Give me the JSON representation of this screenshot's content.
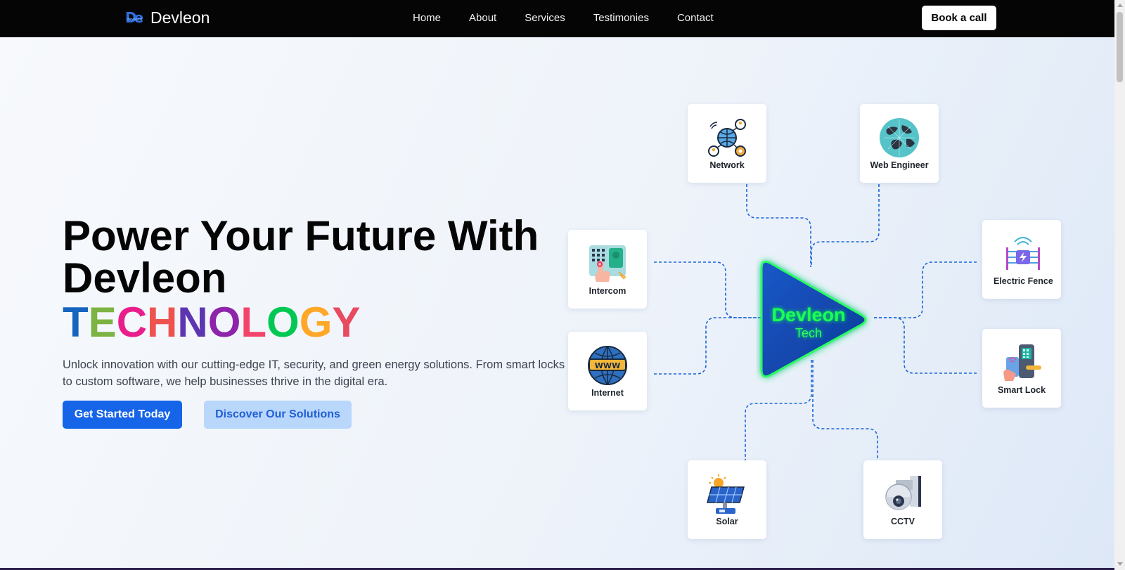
{
  "brand": {
    "name": "Devleon",
    "mark": "De",
    "mark_sub": "devleon"
  },
  "nav": {
    "items": [
      "Home",
      "About",
      "Services",
      "Testimonies",
      "Contact"
    ],
    "cta": "Book a call"
  },
  "hero": {
    "headline": "Power Your Future With Devleon",
    "highlight": "TECHNOLOGY",
    "highlight_colors": [
      "#1565c0",
      "#7cb342",
      "#e91e8c",
      "#ef5350",
      "#5e35b1",
      "#8e24aa",
      "#f4436b",
      "#00c853",
      "#ffa726",
      "#e84a5f",
      "#00bcd4",
      "#26c6da"
    ],
    "lead": "Unlock innovation with our cutting-edge IT, security, and green energy solutions. From smart locks to custom software, we help businesses thrive in the digital era.",
    "primary_button": "Get Started Today",
    "secondary_button": "Discover Our Solutions"
  },
  "diagram": {
    "center_title": "Devleon",
    "center_sub": "Tech",
    "services": [
      {
        "label": "Network",
        "icon": "network-icon"
      },
      {
        "label": "Web Engineer",
        "icon": "globe-icon"
      },
      {
        "label": "Intercom",
        "icon": "intercom-icon"
      },
      {
        "label": "Electric Fence",
        "icon": "electric-fence-icon"
      },
      {
        "label": "Internet",
        "icon": "www-globe-icon"
      },
      {
        "label": "Smart Lock",
        "icon": "smart-lock-icon"
      },
      {
        "label": "Solar",
        "icon": "solar-panel-icon"
      },
      {
        "label": "CCTV",
        "icon": "cctv-camera-icon"
      }
    ]
  },
  "colors": {
    "primary": "#1664e8",
    "secondary_bg": "#b9d6fb",
    "nav_bg": "#050505",
    "glow": "#1cff55"
  }
}
